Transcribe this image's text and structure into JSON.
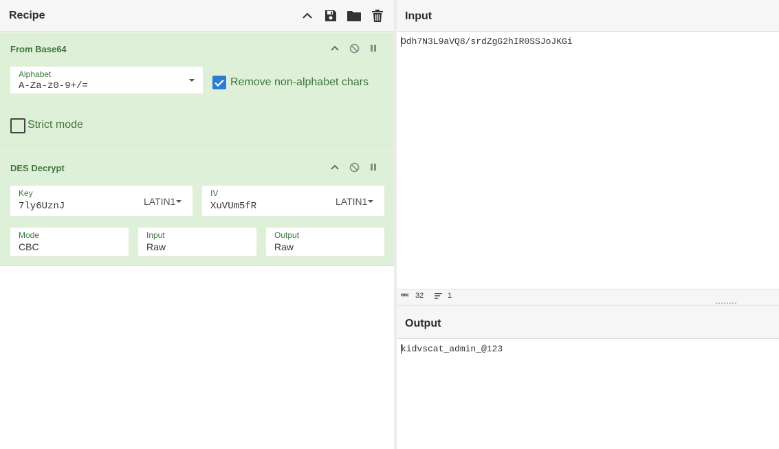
{
  "recipe": {
    "title": "Recipe",
    "header_icons": [
      "chevron-up-icon",
      "save-icon",
      "folder-icon",
      "trash-icon"
    ],
    "operations": [
      {
        "title": "From Base64",
        "alphabet_label": "Alphabet",
        "alphabet_value": "A-Za-z0-9+/=",
        "remove_label": "Remove non-alphabet chars",
        "remove_checked": true,
        "strict_label": "Strict mode",
        "strict_checked": false
      },
      {
        "title": "DES Decrypt",
        "key_label": "Key",
        "key_value": "7ly6UznJ",
        "key_encoding": "LATIN1",
        "iv_label": "IV",
        "iv_value": "XuVUm5fR",
        "iv_encoding": "LATIN1",
        "mode_label": "Mode",
        "mode_value": "CBC",
        "input_label": "Input",
        "input_value": "Raw",
        "output_label": "Output",
        "output_value": "Raw"
      }
    ]
  },
  "input": {
    "title": "Input",
    "text": "Odh7N3L9aVQ8/srdZgG2hIR0SSJoJKGi",
    "status_length": "32",
    "status_lines": "1",
    "status_length_icon": "abc-icon",
    "status_lines_icon": "lines-icon"
  },
  "output": {
    "title": "Output",
    "text": "kidvscat_admin_@123"
  },
  "colors": {
    "op_bg": "#dff0d8",
    "op_text": "#3c763d",
    "checkbox": "#2d7dd2"
  }
}
